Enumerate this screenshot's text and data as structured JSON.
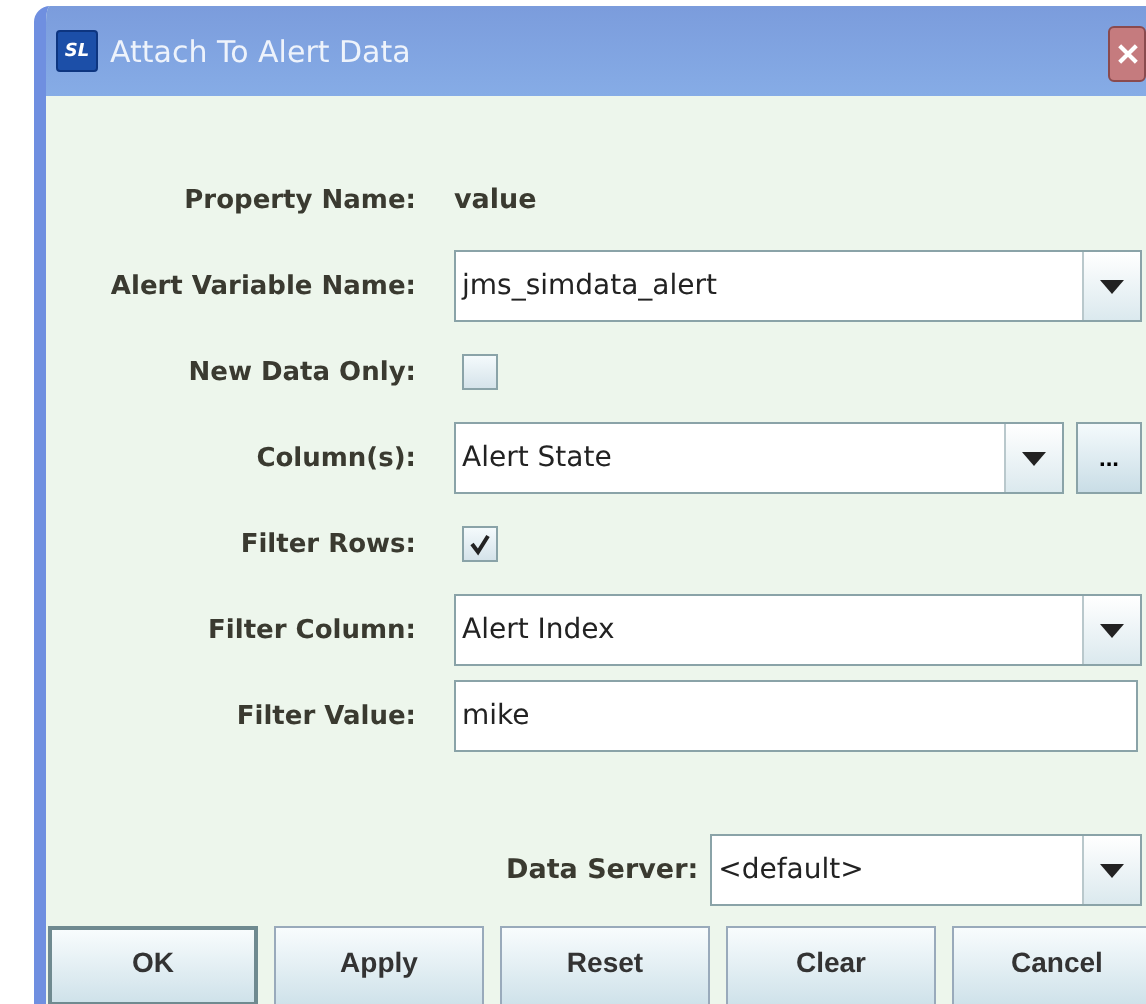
{
  "window": {
    "title": "Attach To Alert Data",
    "logo": "SL"
  },
  "fields": [
    {
      "kind": "text",
      "label": "Property Name:",
      "value": "value"
    },
    {
      "kind": "combo",
      "label": "Alert Variable Name:",
      "value": "jms_simdata_alert"
    },
    {
      "kind": "checkbox",
      "label": "New Data Only:",
      "checked": false
    },
    {
      "kind": "combo-more",
      "label": "Column(s):",
      "value": "Alert State",
      "more": "..."
    },
    {
      "kind": "checkbox",
      "label": "Filter Rows:",
      "checked": true
    },
    {
      "kind": "combo",
      "label": "Filter Column:",
      "value": "Alert Index"
    },
    {
      "kind": "input",
      "label": "Filter Value:",
      "value": "mike"
    }
  ],
  "data_server": {
    "label": "Data Server:",
    "value": "<default>"
  },
  "buttons": [
    "OK",
    "Apply",
    "Reset",
    "Clear",
    "Cancel"
  ]
}
